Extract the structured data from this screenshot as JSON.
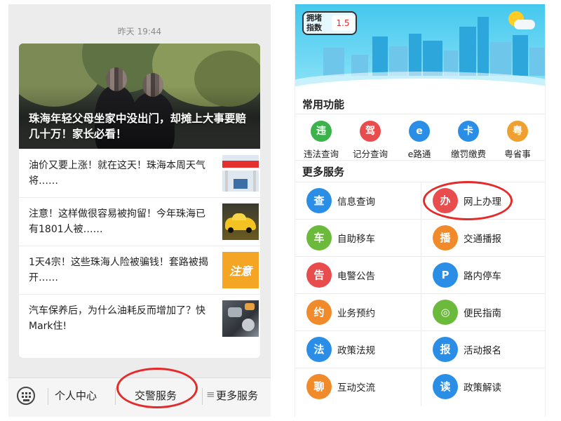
{
  "left": {
    "timestamp": "昨天 19:44",
    "hero_title": "珠海年轻父母坐家中没出门，却摊上大事要赔几十万！家长必看！",
    "articles": [
      {
        "title": "油价又要上涨！就在这天！珠海本周天气将……",
        "thumb": "gas-station"
      },
      {
        "title": "注意！这样做很容易被拘留！今年珠海已有1801人被……",
        "thumb": "yellow-car"
      },
      {
        "title": "1天4宗！这些珠海人险被骗钱！套路被揭开……",
        "thumb": "notice",
        "thumb_text": "注意"
      },
      {
        "title": "汽车保养后，为什么油耗反而增加了？快Mark住!",
        "thumb": "engine"
      }
    ],
    "bottom_bar": {
      "keyboard_icon": "keyboard-icon",
      "items": [
        "个人中心",
        "交警服务",
        "更多服务"
      ],
      "menu_glyph": "≡"
    }
  },
  "right": {
    "congestion": {
      "label": "拥堵指数",
      "value": "1.5"
    },
    "common_title": "常用功能",
    "common_items": [
      {
        "label": "违法查询",
        "color": "#3bb24a",
        "glyph": "违"
      },
      {
        "label": "记分查询",
        "color": "#e84c4c",
        "glyph": "驾"
      },
      {
        "label": "e路通",
        "color": "#2b8ee6",
        "glyph": "e"
      },
      {
        "label": "缴罚缴费",
        "color": "#2b8ee6",
        "glyph": "卡"
      },
      {
        "label": "粤省事",
        "color": "#f0a030",
        "glyph": "粤"
      }
    ],
    "more_title": "更多服务",
    "more_items": [
      {
        "label": "信息查询",
        "color": "#2b8ee6",
        "glyph": "查"
      },
      {
        "label": "网上办理",
        "color": "#e84c4c",
        "glyph": "办"
      },
      {
        "label": "自助移车",
        "color": "#6cba3c",
        "glyph": "车"
      },
      {
        "label": "交通播报",
        "color": "#f08a2a",
        "glyph": "播"
      },
      {
        "label": "电警公告",
        "color": "#e84c4c",
        "glyph": "告"
      },
      {
        "label": "路内停车",
        "color": "#2b8ee6",
        "glyph": "P"
      },
      {
        "label": "业务预约",
        "color": "#f08a2a",
        "glyph": "约"
      },
      {
        "label": "便民指南",
        "color": "#6cba3c",
        "glyph": "◎"
      },
      {
        "label": "政策法规",
        "color": "#2b8ee6",
        "glyph": "法"
      },
      {
        "label": "活动报名",
        "color": "#2b8ee6",
        "glyph": "报"
      },
      {
        "label": "互动交流",
        "color": "#f08a2a",
        "glyph": "聊"
      },
      {
        "label": "政策解读",
        "color": "#2b8ee6",
        "glyph": "读"
      }
    ]
  }
}
